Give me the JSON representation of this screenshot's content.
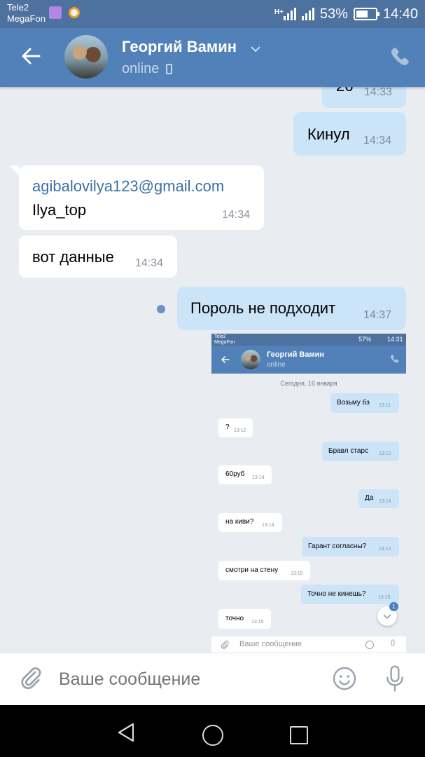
{
  "status_bar": {
    "carrier_1": "Tele2",
    "carrier_2": "MegaFon",
    "network": "H+",
    "battery": "53%",
    "time": "14:40"
  },
  "header": {
    "name": "Георгий Вамин",
    "status": "online"
  },
  "messages": [
    {
      "dir": "out",
      "text": "26",
      "time": "14:33"
    },
    {
      "dir": "out",
      "text": "Кинул",
      "time": "14:34"
    },
    {
      "dir": "in",
      "link": "agibalovilya123@gmail.com",
      "text": "Ilya_top",
      "time": "14:34"
    },
    {
      "dir": "in",
      "text": "вот данные",
      "time": "14:34"
    },
    {
      "dir": "out",
      "text": "Пороль не подходит",
      "time": "14:37"
    }
  ],
  "screenshot": {
    "carrier_1": "Tele2",
    "carrier_2": "MegaFon",
    "battery": "57%",
    "time": "14:31",
    "name": "Георгий Вамин",
    "status": "online",
    "date": "Сегодня, 16 января",
    "messages": [
      {
        "dir": "out",
        "text": "Возьму бз",
        "time": "13:11"
      },
      {
        "dir": "in",
        "text": "?",
        "time": "13:12"
      },
      {
        "dir": "out",
        "text": "Бравл старс",
        "time": "13:12"
      },
      {
        "dir": "in",
        "text": "60руб",
        "time": "13:14"
      },
      {
        "dir": "out",
        "text": "Да",
        "time": "13:14"
      },
      {
        "dir": "in",
        "text": "на киви?",
        "time": "13:14"
      },
      {
        "dir": "out",
        "text": "Гарант согласны?",
        "time": "13:14"
      },
      {
        "dir": "in",
        "text": "смотри на стену",
        "time": "13:15"
      },
      {
        "dir": "out",
        "text": "Точно не кинешь?",
        "time": "13:15"
      },
      {
        "dir": "in",
        "text": "точно",
        "time": "13:15"
      }
    ],
    "unread_badge": "1",
    "input_placeholder": "Ваше сообщение"
  },
  "input": {
    "placeholder": "Ваше сообщение"
  },
  "colors": {
    "header_bg": "#5181b8",
    "status_bg": "#4d72a0",
    "outgoing_bubble": "#cce4f7",
    "incoming_bubble": "#ffffff",
    "link": "#3a6fa8",
    "chat_bg": "#e9edf1"
  },
  "icons": {
    "back": "arrow-left-icon",
    "dropdown": "chevron-down-icon",
    "mobile": "mobile-phone-icon",
    "call": "phone-icon",
    "attach": "paperclip-icon",
    "emoji": "smiley-icon",
    "mic": "microphone-icon"
  }
}
